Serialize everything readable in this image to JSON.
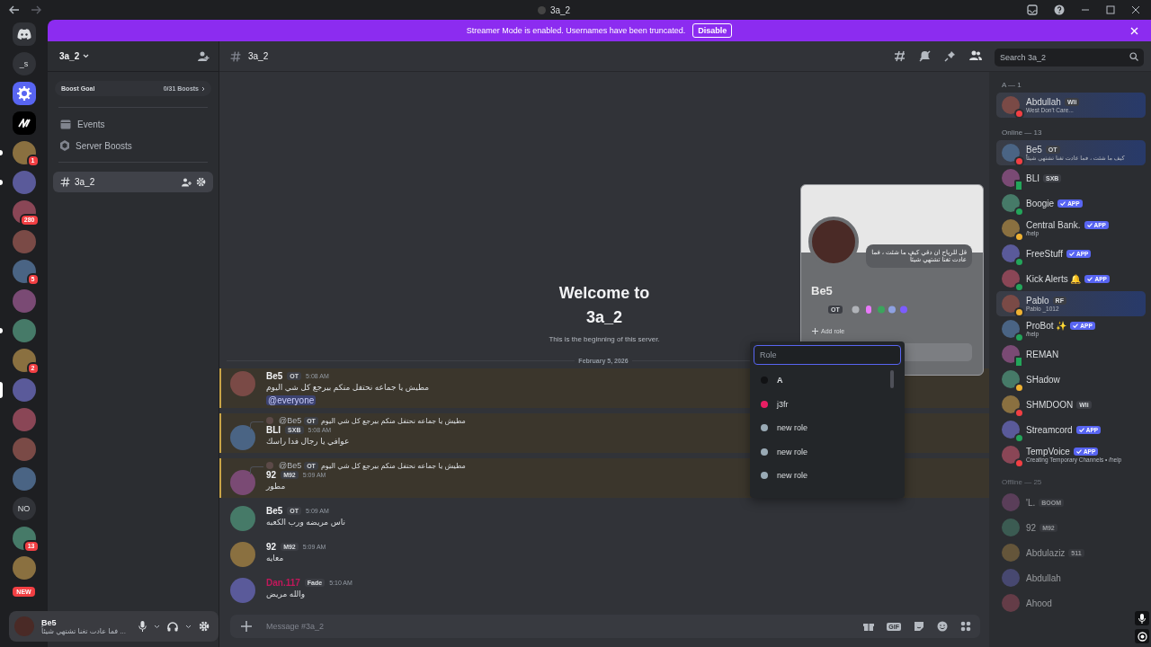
{
  "window": {
    "title": "3a_2"
  },
  "banner": {
    "text": "Streamer Mode is enabled. Usernames have been truncated.",
    "button": "Disable"
  },
  "servers": [
    {
      "kind": "home"
    },
    {
      "kind": "text",
      "label": "_s"
    },
    {
      "kind": "gear"
    },
    {
      "kind": "logo"
    },
    {
      "kind": "image",
      "badge": "1",
      "unread": true
    },
    {
      "kind": "image",
      "unread": true
    },
    {
      "kind": "image",
      "badge": "280"
    },
    {
      "kind": "image"
    },
    {
      "kind": "image",
      "badge": "5"
    },
    {
      "kind": "image"
    },
    {
      "kind": "image",
      "unread": true
    },
    {
      "kind": "image",
      "badge": "2"
    },
    {
      "kind": "image",
      "selected": true
    },
    {
      "kind": "image"
    },
    {
      "kind": "image"
    },
    {
      "kind": "image"
    },
    {
      "kind": "text",
      "label": "NO"
    },
    {
      "kind": "image",
      "badge": "13"
    },
    {
      "kind": "image"
    }
  ],
  "new_badge": "NEW",
  "sidebar": {
    "server_name": "3a_2",
    "boost_goal": {
      "label": "Boost Goal",
      "count": "0/31 Boosts"
    },
    "items": [
      {
        "kind": "events",
        "label": "Events"
      },
      {
        "kind": "boosts",
        "label": "Server Boosts"
      }
    ],
    "channels": [
      {
        "name": "3a_2",
        "selected": true
      }
    ]
  },
  "user_panel": {
    "name": "Be5",
    "status": "... فما عادت تغنا تشتهي شيئاً"
  },
  "header": {
    "channel": "3a_2",
    "search": {
      "placeholder": "Search 3a_2"
    }
  },
  "welcome": {
    "title": "Welcome to 3a_2",
    "subtitle": "This is the beginning of this server."
  },
  "date_divider": "February 5, 2026",
  "messages": [
    {
      "author": "Be5",
      "tag": "OT",
      "time": "5:08 AM",
      "text": "مطيش يا جماعه نحتفل منكم بيرجع كل شي اليوم",
      "mention": "@everyone",
      "highlighted": true,
      "color": "#f2f3f5"
    },
    {
      "reply": {
        "author": "@Be5",
        "tag": "OT",
        "text": "مطيش يا جماعه نحتفل منكم بيرجع كل شي اليوم"
      },
      "author": "BLI",
      "tag": "SXB",
      "time": "5:08 AM",
      "text": "عوافي يا رجال فدا راسك",
      "highlighted": true,
      "color": "#f2f3f5"
    },
    {
      "reply": {
        "author": "@Be5",
        "tag": "OT",
        "text": "مطيش يا جماعه نحتفل منكم بيرجع كل شي اليوم"
      },
      "author": "92",
      "tag": "M92",
      "time": "5:09 AM",
      "text": "مطور",
      "highlighted": true,
      "color": "#f2f3f5"
    },
    {
      "author": "Be5",
      "tag": "OT",
      "time": "5:09 AM",
      "text": "ناس مريضه ورب الكعبه",
      "highlighted": false,
      "color": "#f2f3f5"
    },
    {
      "author": "92",
      "tag": "M92",
      "time": "5:09 AM",
      "text": "معايه",
      "highlighted": false,
      "color": "#f2f3f5"
    },
    {
      "author": "Dan.117",
      "tag": "Fade",
      "time": "5:10 AM",
      "text": "والله مريض",
      "highlighted": false,
      "color": "#c2185b"
    }
  ],
  "composer": {
    "placeholder": "Message #3a_2",
    "gif": "GIF"
  },
  "profile": {
    "name": "Be5",
    "bio": "قل للرياح ان دقي كيف ما شئت ، فما عادت تغنا تشتهي شيئاً",
    "tag": "OT",
    "add_role": "Add role"
  },
  "role_picker": {
    "placeholder": "Role",
    "roles": [
      {
        "name": "A",
        "color": "#111214"
      },
      {
        "name": "j3fr",
        "color": "#e91e63"
      },
      {
        "name": "new role",
        "color": "#99aab5"
      },
      {
        "name": "new role",
        "color": "#99aab5"
      },
      {
        "name": "new role",
        "color": "#99aab5"
      }
    ]
  },
  "members": [
    {
      "title": "A — 1",
      "dimmed": false,
      "members": [
        {
          "name": "Abdullah",
          "tag": "Wli",
          "color": "#f23f43",
          "activity": "West Don't Care...",
          "nameplate": true
        }
      ]
    },
    {
      "title": "Online — 13",
      "dimmed": false,
      "members": [
        {
          "name": "Be5",
          "tag": "OT",
          "color": "#f23f43",
          "activity": "كيف ما شئت ، فما عادت تغنا تشتهي شيئاً",
          "nameplate": true
        },
        {
          "name": "BLI",
          "tag": "SXB",
          "color": "#23a55a",
          "mobile": true
        },
        {
          "name": "Boogie",
          "app": "APP",
          "color": "#23a55a"
        },
        {
          "name": "Central Bank.",
          "app": "APP",
          "color": "#f0b232",
          "activity": "/help"
        },
        {
          "name": "FreeStuff",
          "app": "APP",
          "color": "#23a55a"
        },
        {
          "name": "Kick Alerts 🔔",
          "app": "APP",
          "color": "#23a55a"
        },
        {
          "name": "Pablo",
          "tag": "RF",
          "color": "#f0b232",
          "activity": "Pablo _1012",
          "nameplate": true
        },
        {
          "name": "ProBot ✨",
          "app": "APP",
          "color": "#23a55a",
          "activity": "/help"
        },
        {
          "name": "REMAN",
          "color": "#23a55a",
          "mobile": true
        },
        {
          "name": "SHadow",
          "color": "#f0b232"
        },
        {
          "name": "SHMDOON",
          "tag": "Wli",
          "color": "#f23f43"
        },
        {
          "name": "Streamcord",
          "app": "APP",
          "color": "#23a55a"
        },
        {
          "name": "TempVoice",
          "app": "APP",
          "color": "#f23f43",
          "activity": "Creating Temporary Channels • /help"
        }
      ]
    },
    {
      "title": "Offline — 25",
      "dimmed": true,
      "members": [
        {
          "name": "'L.",
          "tag": "BOOM"
        },
        {
          "name": "92",
          "tag": "M92"
        },
        {
          "name": "Abdulaziz",
          "tag": "511"
        },
        {
          "name": "Abdullah"
        },
        {
          "name": "Ahood"
        }
      ]
    }
  ]
}
